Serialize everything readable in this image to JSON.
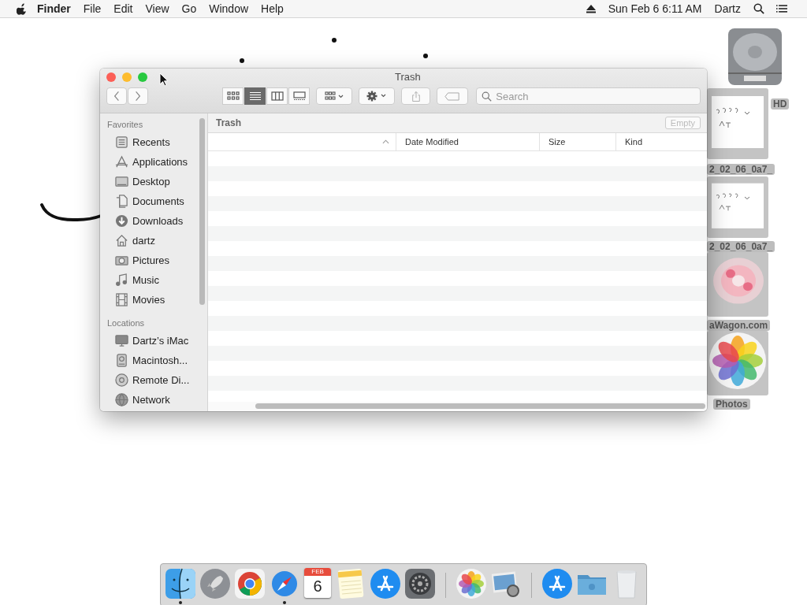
{
  "menu_bar": {
    "app": "Finder",
    "menus": [
      "File",
      "Edit",
      "View",
      "Go",
      "Window",
      "Help"
    ],
    "clock": "Sun Feb 6  6:11 AM",
    "user": "Dartz"
  },
  "desktop_icons": [
    {
      "kind": "drive",
      "label": "HD"
    },
    {
      "kind": "picture",
      "label": "2_02_06_0a7_"
    },
    {
      "kind": "picture",
      "label": "2_02_06_0a7_"
    },
    {
      "kind": "picture",
      "label": "aWagon.com"
    },
    {
      "kind": "photos",
      "label": "Photos"
    }
  ],
  "window": {
    "title": "Trash",
    "view_modes": [
      {
        "kind": "icons",
        "selected": false
      },
      {
        "kind": "list",
        "selected": true
      },
      {
        "kind": "columns",
        "selected": false
      },
      {
        "kind": "gallery",
        "selected": false
      }
    ],
    "search": {
      "placeholder": "Search"
    },
    "sidebar": [
      {
        "heading": "Favorites",
        "items": [
          {
            "label": "Recents"
          },
          {
            "label": "Applications"
          },
          {
            "label": "Desktop"
          },
          {
            "label": "Documents"
          },
          {
            "label": "Downloads"
          },
          {
            "label": "dartz"
          },
          {
            "label": "Pictures"
          },
          {
            "label": "Music"
          },
          {
            "label": "Movies"
          }
        ]
      },
      {
        "heading": "Locations",
        "items": [
          {
            "label": "Dartz’s iMac"
          },
          {
            "label": "Macintosh..."
          },
          {
            "label": "Remote Di..."
          },
          {
            "label": "Network"
          }
        ]
      }
    ],
    "path": "Trash",
    "empty_button": {
      "label": "Empty",
      "disabled": true
    },
    "columns": [
      {
        "sorted": true
      },
      {
        "label": "Date Modified",
        "sorted": false
      },
      {
        "label": "Size",
        "sorted": false
      },
      {
        "label": "Kind",
        "sorted": false
      }
    ]
  },
  "dock": [
    {
      "kind": "finder",
      "running": true
    },
    {
      "kind": "launchpad",
      "running": false
    },
    {
      "kind": "chrome",
      "running": false
    },
    {
      "kind": "safari",
      "running": true
    },
    {
      "kind": "calendar",
      "running": false,
      "month": "FEB",
      "day": "6"
    },
    {
      "kind": "notes",
      "running": false
    },
    {
      "kind": "appstore",
      "running": false
    },
    {
      "kind": "settings",
      "running": false
    },
    {
      "kind": "separator"
    },
    {
      "kind": "photos",
      "running": false
    },
    {
      "kind": "preview",
      "running": false
    },
    {
      "kind": "separator"
    },
    {
      "kind": "appstore",
      "running": false
    },
    {
      "kind": "folder",
      "running": false
    },
    {
      "kind": "trash",
      "running": false
    }
  ]
}
